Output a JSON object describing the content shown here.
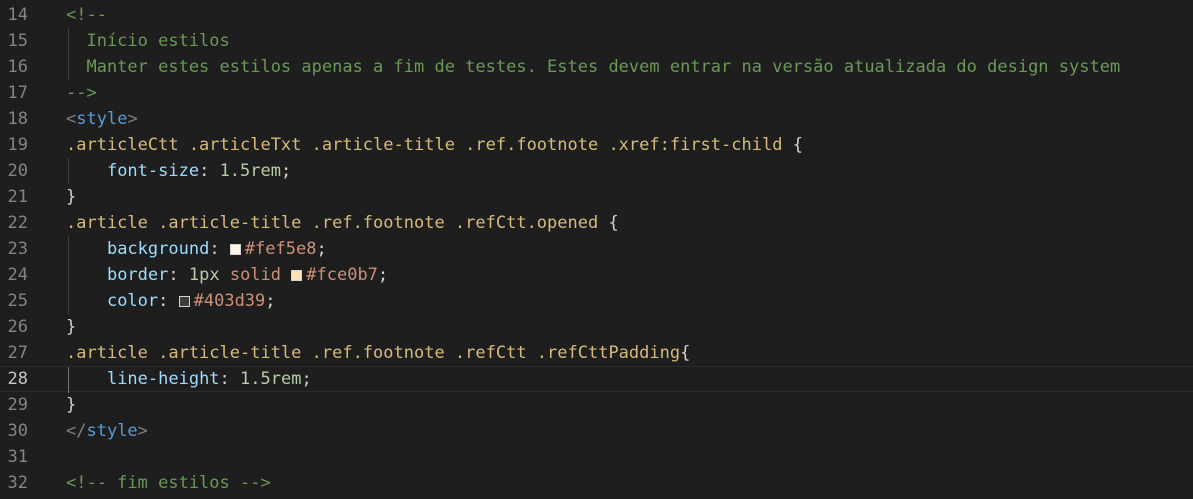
{
  "editor": {
    "lines": [
      {
        "number": "14",
        "segments": [
          {
            "t": "<!--",
            "c": "c-comment"
          }
        ]
      },
      {
        "number": "15",
        "guide": true,
        "segments": [
          {
            "t": "  Início estilos",
            "c": "c-comment"
          }
        ]
      },
      {
        "number": "16",
        "guide": true,
        "segments": [
          {
            "t": "  Manter estes estilos apenas a fim de testes. Estes devem entrar na versão atualizada do design system",
            "c": "c-comment"
          }
        ]
      },
      {
        "number": "17",
        "segments": [
          {
            "t": "-->",
            "c": "c-comment"
          }
        ]
      },
      {
        "number": "18",
        "segments": [
          {
            "t": "<",
            "c": "c-punct"
          },
          {
            "t": "style",
            "c": "c-tag"
          },
          {
            "t": ">",
            "c": "c-punct"
          }
        ]
      },
      {
        "number": "19",
        "segments": [
          {
            "t": ".articleCtt .articleTxt .article-title .ref.footnote .xref:first-child",
            "c": "c-sel"
          },
          {
            "t": " {",
            "c": "c-brace"
          }
        ]
      },
      {
        "number": "20",
        "guide": true,
        "segments": [
          {
            "t": "    ",
            "c": "c-text"
          },
          {
            "t": "font-size",
            "c": "c-prop"
          },
          {
            "t": ": ",
            "c": "c-text"
          },
          {
            "t": "1.5rem",
            "c": "c-num"
          },
          {
            "t": ";",
            "c": "c-text"
          }
        ]
      },
      {
        "number": "21",
        "segments": [
          {
            "t": "}",
            "c": "c-brace"
          }
        ]
      },
      {
        "number": "22",
        "segments": [
          {
            "t": ".article .article-title .ref.footnote .refCtt.opened",
            "c": "c-sel"
          },
          {
            "t": " {",
            "c": "c-brace"
          }
        ]
      },
      {
        "number": "23",
        "guide": true,
        "segments": [
          {
            "t": "    ",
            "c": "c-text"
          },
          {
            "t": "background",
            "c": "c-prop"
          },
          {
            "t": ": ",
            "c": "c-text"
          },
          {
            "swatch": "#fef5e8"
          },
          {
            "t": "#fef5e8",
            "c": "c-str"
          },
          {
            "t": ";",
            "c": "c-text"
          }
        ]
      },
      {
        "number": "24",
        "guide": true,
        "segments": [
          {
            "t": "    ",
            "c": "c-text"
          },
          {
            "t": "border",
            "c": "c-prop"
          },
          {
            "t": ": ",
            "c": "c-text"
          },
          {
            "t": "1px",
            "c": "c-num"
          },
          {
            "t": " ",
            "c": "c-text"
          },
          {
            "t": "solid",
            "c": "c-str"
          },
          {
            "t": " ",
            "c": "c-text"
          },
          {
            "swatch": "#fce0b7"
          },
          {
            "t": "#fce0b7",
            "c": "c-str"
          },
          {
            "t": ";",
            "c": "c-text"
          }
        ]
      },
      {
        "number": "25",
        "guide": true,
        "segments": [
          {
            "t": "    ",
            "c": "c-text"
          },
          {
            "t": "color",
            "c": "c-prop"
          },
          {
            "t": ": ",
            "c": "c-text"
          },
          {
            "swatch": "#403d39"
          },
          {
            "t": "#403d39",
            "c": "c-str"
          },
          {
            "t": ";",
            "c": "c-text"
          }
        ]
      },
      {
        "number": "26",
        "segments": [
          {
            "t": "}",
            "c": "c-brace"
          }
        ]
      },
      {
        "number": "27",
        "segments": [
          {
            "t": ".article .article-title .ref.footnote .refCtt .refCttPadding",
            "c": "c-sel"
          },
          {
            "t": "{",
            "c": "c-brace"
          }
        ]
      },
      {
        "number": "28",
        "guide": true,
        "current": true,
        "segments": [
          {
            "t": "    ",
            "c": "c-text"
          },
          {
            "t": "line-height",
            "c": "c-prop"
          },
          {
            "t": ": ",
            "c": "c-text"
          },
          {
            "t": "1.5rem",
            "c": "c-num"
          },
          {
            "t": ";",
            "c": "c-text"
          }
        ]
      },
      {
        "number": "29",
        "segments": [
          {
            "t": "}",
            "c": "c-brace"
          }
        ]
      },
      {
        "number": "30",
        "segments": [
          {
            "t": "</",
            "c": "c-punct"
          },
          {
            "t": "style",
            "c": "c-tag"
          },
          {
            "t": ">",
            "c": "c-punct"
          }
        ]
      },
      {
        "number": "31",
        "segments": []
      },
      {
        "number": "32",
        "segments": [
          {
            "t": "<!-- fim estilos -->",
            "c": "c-comment"
          }
        ]
      }
    ]
  }
}
